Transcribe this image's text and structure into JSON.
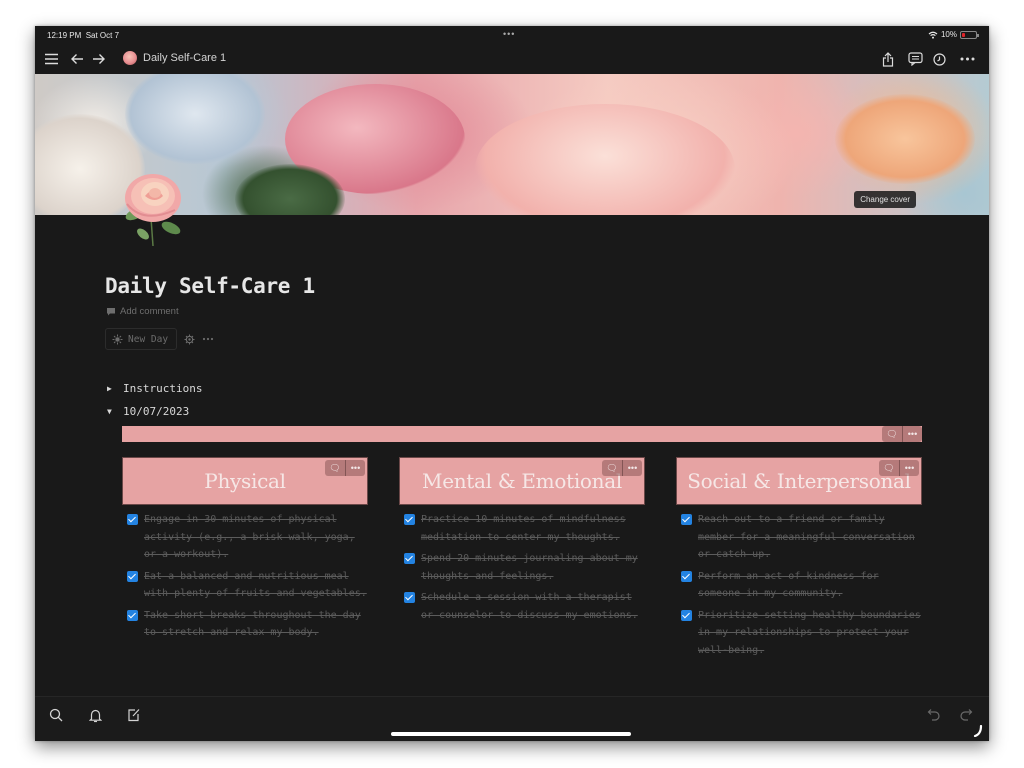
{
  "status_bar": {
    "time": "12:19 PM",
    "date": "Sat Oct 7",
    "multitask_dots": "•••",
    "battery_percent": "10%",
    "wifi_icon": "wifi-icon",
    "battery_icon": "battery-low-icon"
  },
  "toolbar": {
    "menu_icon": "hamburger-menu-icon",
    "back_icon": "arrow-left-icon",
    "forward_icon": "arrow-right-icon",
    "page_title": "Daily Self-Care 1",
    "page_emoji": "rose-icon",
    "share_icon": "share-icon",
    "comments_icon": "comments-icon",
    "history_icon": "clock-icon",
    "more_icon": "more-icon"
  },
  "cover": {
    "change_cover_label": "Change cover"
  },
  "page": {
    "title": "Daily Self-Care 1",
    "add_comment_label": "Add comment",
    "new_day_button_label": "New Day",
    "instructions_toggle_label": "Instructions",
    "date_toggle_label": "10/07/2023",
    "accent_color": "#e6a3a3",
    "checkbox_color": "#2383e2"
  },
  "columns": [
    {
      "heading": "Physical",
      "todos": [
        {
          "text": "Engage in 30 minutes of physical activity (e.g., a brisk walk, yoga, or a workout).",
          "checked": true
        },
        {
          "text": "Eat a balanced and nutritious meal with plenty of fruits and vegetables.",
          "checked": true
        },
        {
          "text": "Take short breaks throughout the day to stretch and relax my body.",
          "checked": true
        }
      ]
    },
    {
      "heading": "Mental & Emotional",
      "todos": [
        {
          "text": "Practice 10 minutes of mindfulness meditation to center my thoughts.",
          "checked": true
        },
        {
          "text": "Spend 20 minutes journaling about my thoughts and feelings.",
          "checked": true
        },
        {
          "text": "Schedule a session with a therapist or counselor to discuss my emotions.",
          "checked": true
        }
      ]
    },
    {
      "heading": "Social & Interpersonal",
      "todos": [
        {
          "text": "Reach out to a friend or family member for a meaningful conversation or catch up.",
          "checked": true
        },
        {
          "text": "Perform an act of kindness for someone in my community.",
          "checked": true
        },
        {
          "text": "Prioritize setting healthy boundaries in my relationships to protect your well-being.",
          "checked": true
        }
      ]
    }
  ],
  "bottom_bar": {
    "search_icon": "search-icon",
    "notifications_icon": "bell-icon",
    "new_page_icon": "compose-icon",
    "undo_icon": "undo-icon",
    "redo_icon": "redo-icon"
  }
}
